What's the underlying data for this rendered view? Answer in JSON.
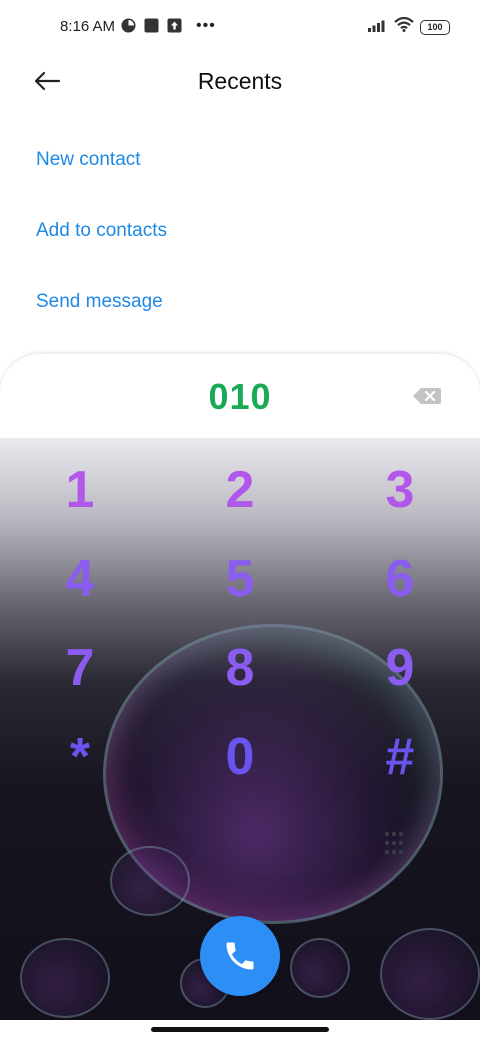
{
  "status_bar": {
    "time": "8:16 AM",
    "battery": "100",
    "more_dots": "•••"
  },
  "header": {
    "title": "Recents"
  },
  "actions": {
    "new_contact": "New contact",
    "add_to_contacts": "Add to contacts",
    "send_message": "Send message"
  },
  "dialer": {
    "number": "010",
    "keys": [
      "1",
      "2",
      "3",
      "4",
      "5",
      "6",
      "7",
      "8",
      "9",
      "*",
      "0",
      "#"
    ]
  },
  "colors": {
    "accent": "#1e88e5",
    "number": "#1aaa55",
    "call_button": "#2d8ef5"
  }
}
